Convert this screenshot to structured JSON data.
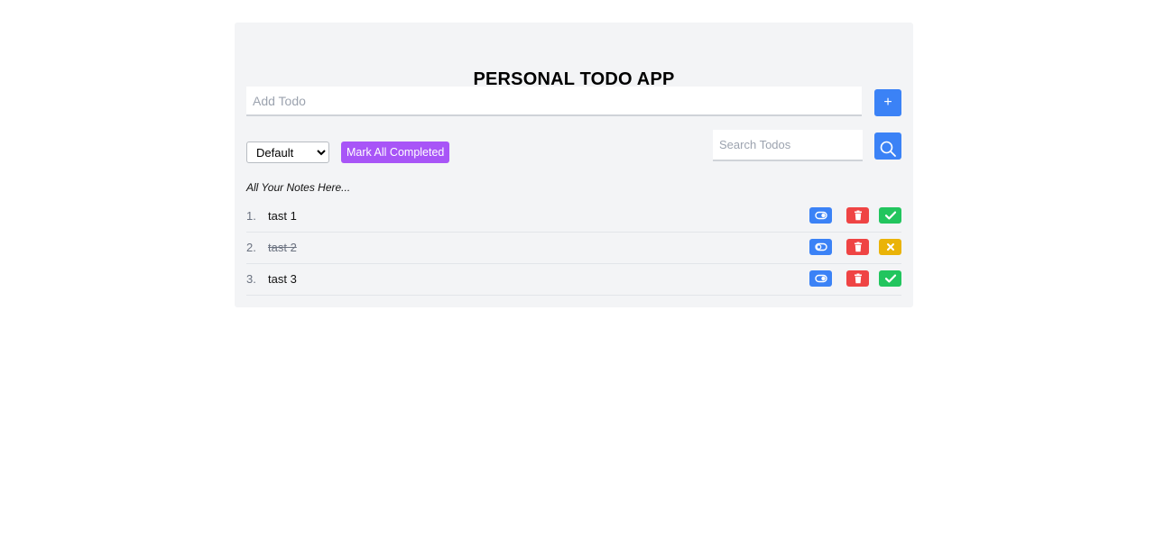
{
  "app": {
    "title": "PERSONAL TODO APP"
  },
  "add": {
    "placeholder": "Add Todo",
    "value": "",
    "button_label": "+"
  },
  "controls": {
    "sort_selected": "Default",
    "mark_all_label": "Mark All Completed",
    "search_placeholder": "Search Todos",
    "search_icon": "search-icon"
  },
  "notes_label": "All Your Notes Here...",
  "todos": [
    {
      "number": "1.",
      "text": "tast 1",
      "completed": false
    },
    {
      "number": "2.",
      "text": "tast 2",
      "completed": true
    },
    {
      "number": "3.",
      "text": "tast 3",
      "completed": false
    }
  ],
  "colors": {
    "primary": "#3b82f6",
    "purple": "#a855f7",
    "danger": "#ef4444",
    "success": "#22c55e",
    "warning": "#eab308",
    "card_bg": "#f3f4f6"
  }
}
